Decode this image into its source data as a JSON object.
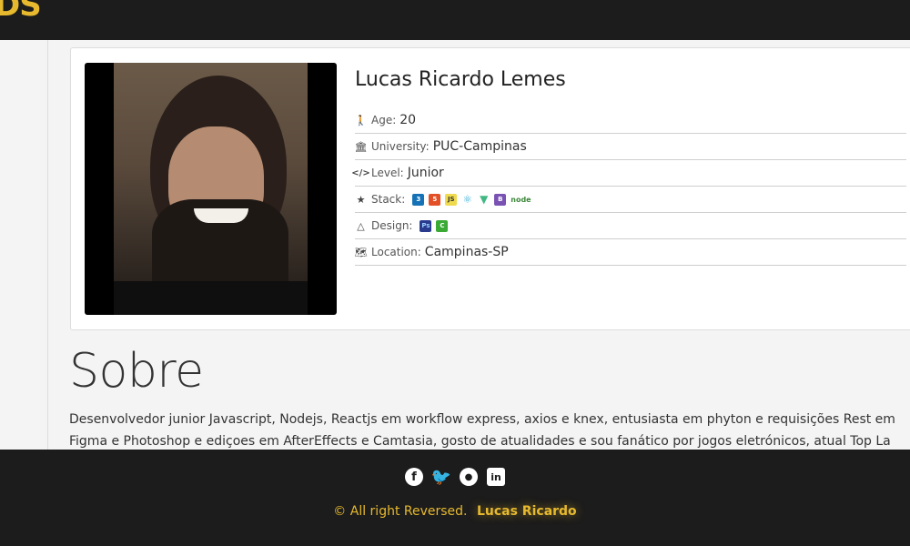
{
  "header": {
    "logo": "DS"
  },
  "profile": {
    "name": "Lucas Ricardo Lemes",
    "rows": {
      "age": {
        "label": "Age:",
        "value": "20",
        "icon": "child-icon"
      },
      "university": {
        "label": "University:",
        "value": "PUC-Campinas",
        "icon": "university-icon"
      },
      "level": {
        "label": "Level:",
        "value": "Junior",
        "icon": "code-icon"
      },
      "stack": {
        "label": "Stack:",
        "icon": "star-icon",
        "badges": [
          "css3",
          "html5",
          "js",
          "react",
          "vue",
          "bootstrap",
          "node"
        ]
      },
      "design": {
        "label": "Design:",
        "icon": "adobe-icon",
        "badges": [
          "photoshop",
          "camtasia"
        ]
      },
      "location": {
        "label": "Location:",
        "value": "Campinas-SP",
        "icon": "map-icon"
      }
    }
  },
  "sobre": {
    "title": "Sobre",
    "line1": "Desenvolvedor junior Javascript, Nodejs, Reactjs em workflow express, axios e knex, entusiasta em phyton e requisições Rest em",
    "line2": "Figma e Photoshop e ediçoes em AfterEffects e Camtasia, gosto de atualidades e sou fanático por jogos eletrónicos, atual Top La"
  },
  "footer": {
    "social": [
      "facebook",
      "twitter",
      "github",
      "linkedin"
    ],
    "copyright": "© All right Reversed.",
    "author": "Lucas Ricardo"
  },
  "colors": {
    "accent": "#e7b92e",
    "dark": "#1c1c1c"
  }
}
